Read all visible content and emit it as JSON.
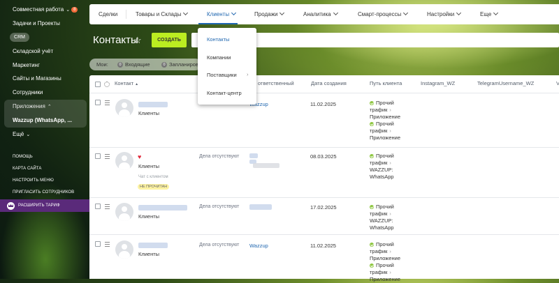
{
  "sidebar": {
    "items": [
      {
        "label": "Совместная работа",
        "badge": "8"
      },
      {
        "label": "Задачи и Проекты"
      },
      {
        "label": "CRM"
      },
      {
        "label": "Складской учёт"
      },
      {
        "label": "Маркетинг"
      },
      {
        "label": "Сайты и Магазины"
      },
      {
        "label": "Сотрудники"
      },
      {
        "label": "Приложения"
      },
      {
        "label": "Wazzup (WhatsApp, ..."
      },
      {
        "label": "Ещё"
      }
    ],
    "links": [
      "ПОМОЩЬ",
      "КАРТА САЙТА",
      "НАСТРОИТЬ МЕНЮ",
      "ПРИГЛАСИТЬ СОТРУДНИКОВ"
    ],
    "upgrade_label": "РАСШИРИТЬ ТАРИФ"
  },
  "topnav": {
    "items": [
      "Сделки",
      "Товары и Склады",
      "Клиенты",
      "Продажи",
      "Аналитика",
      "Смарт-процессы",
      "Настройки",
      "Еще"
    ],
    "active": "Клиенты"
  },
  "dropdown": {
    "items": [
      "Контакты",
      "Компании",
      "Поставщики",
      "Контакт-центр"
    ]
  },
  "page": {
    "title": "Контакты",
    "create_label": "СОЗДАТЬ"
  },
  "counters": {
    "label": "Мои:",
    "incoming_count": "0",
    "incoming_label": "Входящие",
    "planned_count": "0",
    "planned_label": "Запланиров"
  },
  "table": {
    "columns": [
      "Контакт",
      "ответственный",
      "Дата создания",
      "Путь клиента",
      "Instagram_WZ",
      "TelegramUsername_WZ"
    ],
    "sort_arrow": "▲",
    "rows": [
      {
        "type": "Клиенты",
        "activity": "",
        "responsible": "Wazzup",
        "date": "11.02.2025",
        "path": [
          "Прочий",
          "трафик",
          "Приложение",
          "Прочий",
          "трафик",
          "Приложение"
        ]
      },
      {
        "type": "Клиенты",
        "activity": "Дела отсутствуют",
        "responsible": "",
        "date": "08.03.2025",
        "chat_label": "Чат с клиентом",
        "status": "НЕ ПРОЧИТАН",
        "path": [
          "Прочий",
          "трафик",
          "WAZZUP:",
          "WhatsApp"
        ]
      },
      {
        "type": "Клиенты",
        "activity": "Дела отсутствуют",
        "responsible": "",
        "date": "17.02.2025",
        "path": [
          "Прочий",
          "трафик",
          "WAZZUP:",
          "WhatsApp"
        ]
      },
      {
        "type": "Клиенты",
        "activity": "Дела отсутствуют",
        "responsible": "Wazzup",
        "date": "11.02.2025",
        "path": [
          "Прочий",
          "трафик",
          "Приложение",
          "Прочий",
          "трафик",
          "Приложение"
        ]
      }
    ]
  },
  "colors": {
    "accent": "#2067b0",
    "create_button": "#bbed21",
    "badge": "#f26c3b",
    "upgrade": "#5a2a7a"
  }
}
